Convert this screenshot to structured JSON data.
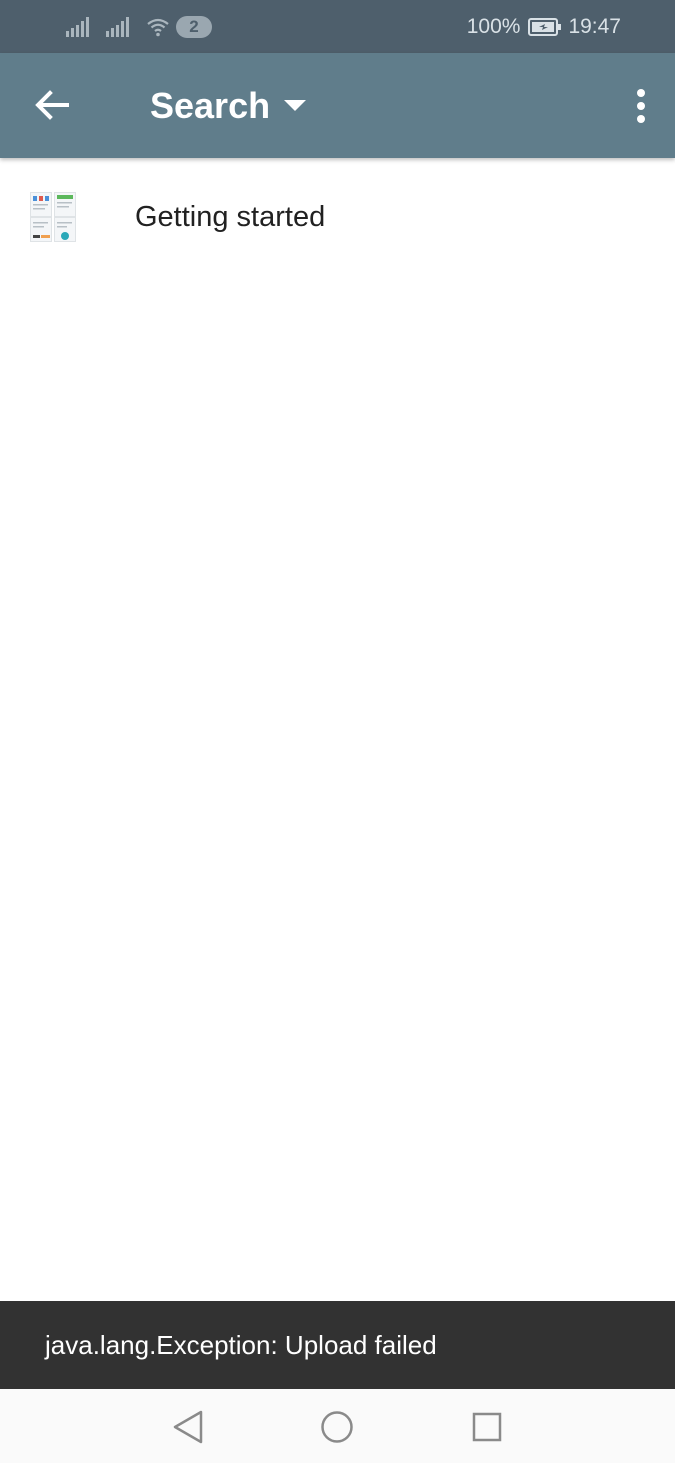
{
  "status_bar": {
    "notification_count": "2",
    "battery_percent": "100%",
    "time": "19:47",
    "icons": [
      "signal-icon",
      "signal-icon",
      "wifi-icon",
      "battery-charging-icon"
    ]
  },
  "toolbar": {
    "title": "Search",
    "background_color": "#607d8b",
    "icons": [
      "back-arrow-icon",
      "dropdown-arrow-icon",
      "more-vert-icon"
    ]
  },
  "results": [
    {
      "title": "Getting started",
      "icon": "document-thumbnail"
    }
  ],
  "snackbar": {
    "message": "java.lang.Exception: Upload failed"
  },
  "navigation_bar": {
    "icons": [
      "back-triangle-icon",
      "home-circle-icon",
      "recents-square-icon"
    ]
  }
}
